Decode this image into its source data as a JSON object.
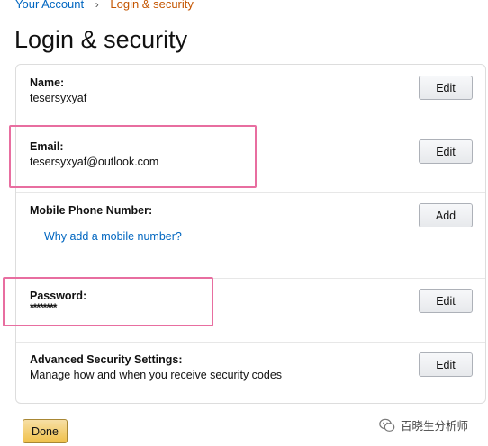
{
  "breadcrumb": {
    "parent": "Your Account",
    "separator": "›",
    "current": "Login & security"
  },
  "page": {
    "title": "Login & security"
  },
  "rows": {
    "name": {
      "label": "Name:",
      "value": "tesersyxyaf",
      "button": "Edit"
    },
    "email": {
      "label": "Email:",
      "value": "tesersyxyaf@outlook.com",
      "button": "Edit"
    },
    "mobile": {
      "label": "Mobile Phone Number:",
      "link": "Why add a mobile number?",
      "button": "Add"
    },
    "password": {
      "label": "Password:",
      "value": "********",
      "button": "Edit"
    },
    "advanced": {
      "label": "Advanced Security Settings:",
      "value": "Manage how and when you receive security codes",
      "button": "Edit"
    }
  },
  "actions": {
    "done": "Done"
  },
  "watermark": {
    "text": "百晓生分析师",
    "icon": "wechat-icon"
  },
  "colors": {
    "link": "#0066c0",
    "breadcrumb_current": "#c45500",
    "highlight": "#e86ea0",
    "done_button": "#f0c14b"
  }
}
